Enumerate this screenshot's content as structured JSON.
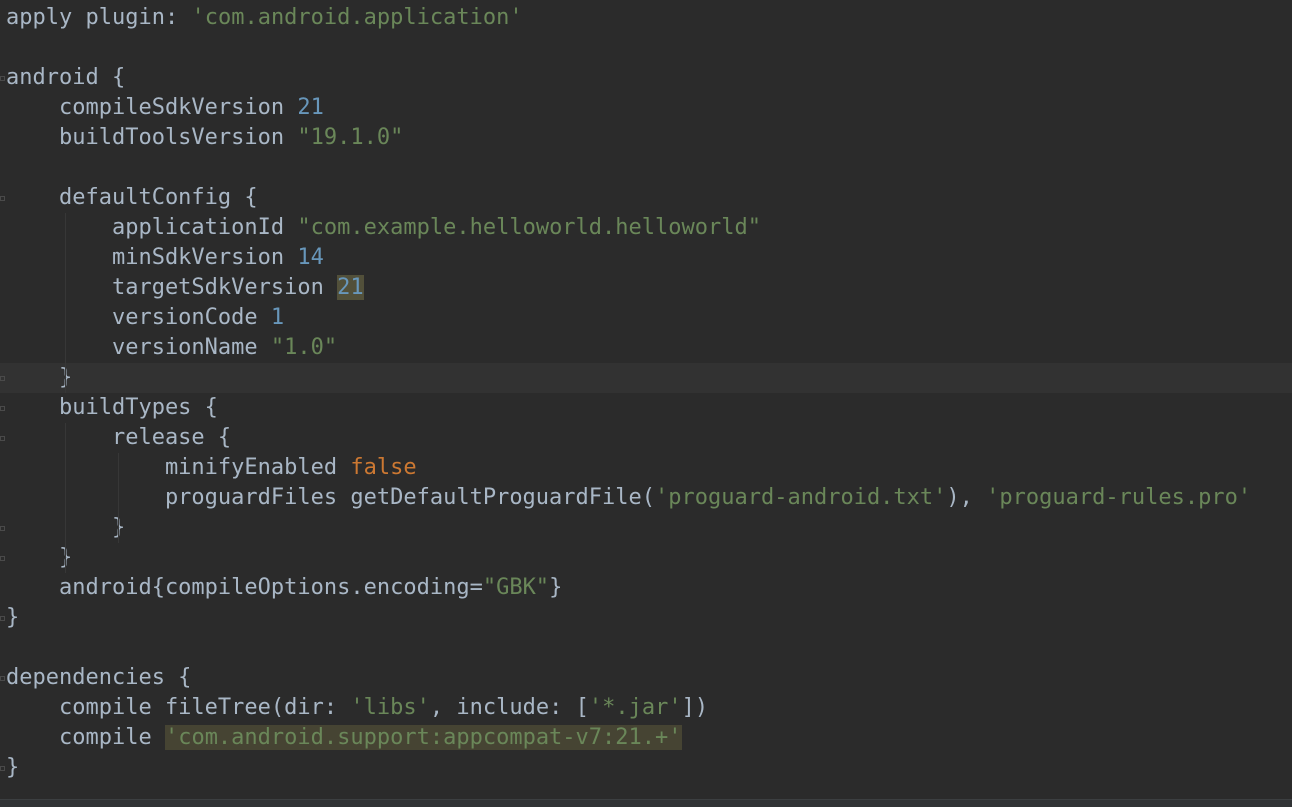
{
  "editor": {
    "lines": [
      {
        "id": "l1",
        "tokens": [
          {
            "t": "apply ",
            "c": "plain"
          },
          {
            "t": "plugin",
            "c": "plain"
          },
          {
            "t": ": ",
            "c": "plain"
          },
          {
            "t": "'com.android.application'",
            "c": "str"
          }
        ]
      },
      {
        "id": "l2",
        "tokens": []
      },
      {
        "id": "l3",
        "tokens": [
          {
            "t": "android {",
            "c": "plain"
          }
        ]
      },
      {
        "id": "l4",
        "tokens": [
          {
            "t": "    compileSdkVersion ",
            "c": "plain"
          },
          {
            "t": "21",
            "c": "num"
          }
        ]
      },
      {
        "id": "l5",
        "tokens": [
          {
            "t": "    buildToolsVersion ",
            "c": "plain"
          },
          {
            "t": "\"19.1.0\"",
            "c": "str"
          }
        ]
      },
      {
        "id": "l6",
        "tokens": []
      },
      {
        "id": "l7",
        "tokens": [
          {
            "t": "    defaultConfig {",
            "c": "plain"
          }
        ]
      },
      {
        "id": "l8",
        "tokens": [
          {
            "t": "        applicationId ",
            "c": "plain"
          },
          {
            "t": "\"com.example.helloworld.helloworld\"",
            "c": "str"
          }
        ]
      },
      {
        "id": "l9",
        "tokens": [
          {
            "t": "        minSdkVersion ",
            "c": "plain"
          },
          {
            "t": "14",
            "c": "num"
          }
        ]
      },
      {
        "id": "l10",
        "tokens": [
          {
            "t": "        targetSdkVersion ",
            "c": "plain"
          },
          {
            "t": "21",
            "c": "num hl-num"
          }
        ]
      },
      {
        "id": "l11",
        "tokens": [
          {
            "t": "        versionCode ",
            "c": "plain"
          },
          {
            "t": "1",
            "c": "num"
          }
        ]
      },
      {
        "id": "l12",
        "tokens": [
          {
            "t": "        versionName ",
            "c": "plain"
          },
          {
            "t": "\"1.0\"",
            "c": "str"
          }
        ]
      },
      {
        "id": "l13",
        "tokens": [
          {
            "t": "    }",
            "c": "plain"
          }
        ]
      },
      {
        "id": "l14",
        "tokens": [
          {
            "t": "    buildTypes {",
            "c": "plain"
          }
        ]
      },
      {
        "id": "l15",
        "tokens": [
          {
            "t": "        release {",
            "c": "plain"
          }
        ]
      },
      {
        "id": "l16",
        "tokens": [
          {
            "t": "            minifyEnabled ",
            "c": "plain"
          },
          {
            "t": "false",
            "c": "kw"
          }
        ]
      },
      {
        "id": "l17",
        "tokens": [
          {
            "t": "            proguardFiles getDefaultProguardFile(",
            "c": "plain"
          },
          {
            "t": "'proguard-android.txt'",
            "c": "str"
          },
          {
            "t": "), ",
            "c": "plain"
          },
          {
            "t": "'proguard-rules.pro'",
            "c": "str"
          }
        ]
      },
      {
        "id": "l18",
        "tokens": [
          {
            "t": "        }",
            "c": "plain"
          }
        ]
      },
      {
        "id": "l19",
        "tokens": [
          {
            "t": "    }",
            "c": "plain"
          }
        ]
      },
      {
        "id": "l20",
        "tokens": [
          {
            "t": "    android{compileOptions.encoding=",
            "c": "plain"
          },
          {
            "t": "\"GBK\"",
            "c": "str"
          },
          {
            "t": "}",
            "c": "plain"
          }
        ]
      },
      {
        "id": "l21",
        "tokens": [
          {
            "t": "}",
            "c": "plain"
          }
        ]
      },
      {
        "id": "l22",
        "tokens": []
      },
      {
        "id": "l23",
        "tokens": [
          {
            "t": "dependencies {",
            "c": "plain"
          }
        ]
      },
      {
        "id": "l24",
        "tokens": [
          {
            "t": "    compile fileTree(",
            "c": "plain"
          },
          {
            "t": "dir",
            "c": "plain"
          },
          {
            "t": ": ",
            "c": "plain"
          },
          {
            "t": "'libs'",
            "c": "str"
          },
          {
            "t": ", ",
            "c": "plain"
          },
          {
            "t": "include",
            "c": "plain"
          },
          {
            "t": ": [",
            "c": "plain"
          },
          {
            "t": "'*.jar'",
            "c": "str"
          },
          {
            "t": "])",
            "c": "plain"
          }
        ]
      },
      {
        "id": "l25",
        "tokens": [
          {
            "t": "    compile ",
            "c": "plain"
          },
          {
            "t": "'com.android.support:appcompat-v7:21.+'",
            "c": "str hl-warn"
          }
        ]
      },
      {
        "id": "l26",
        "tokens": [
          {
            "t": "}",
            "c": "plain"
          }
        ]
      }
    ]
  },
  "colors": {
    "background": "#2b2b2b",
    "current_line": "#323232",
    "plain": "#a9b7c6",
    "string": "#6a8759",
    "number": "#6897bb",
    "keyword": "#cc7832"
  }
}
